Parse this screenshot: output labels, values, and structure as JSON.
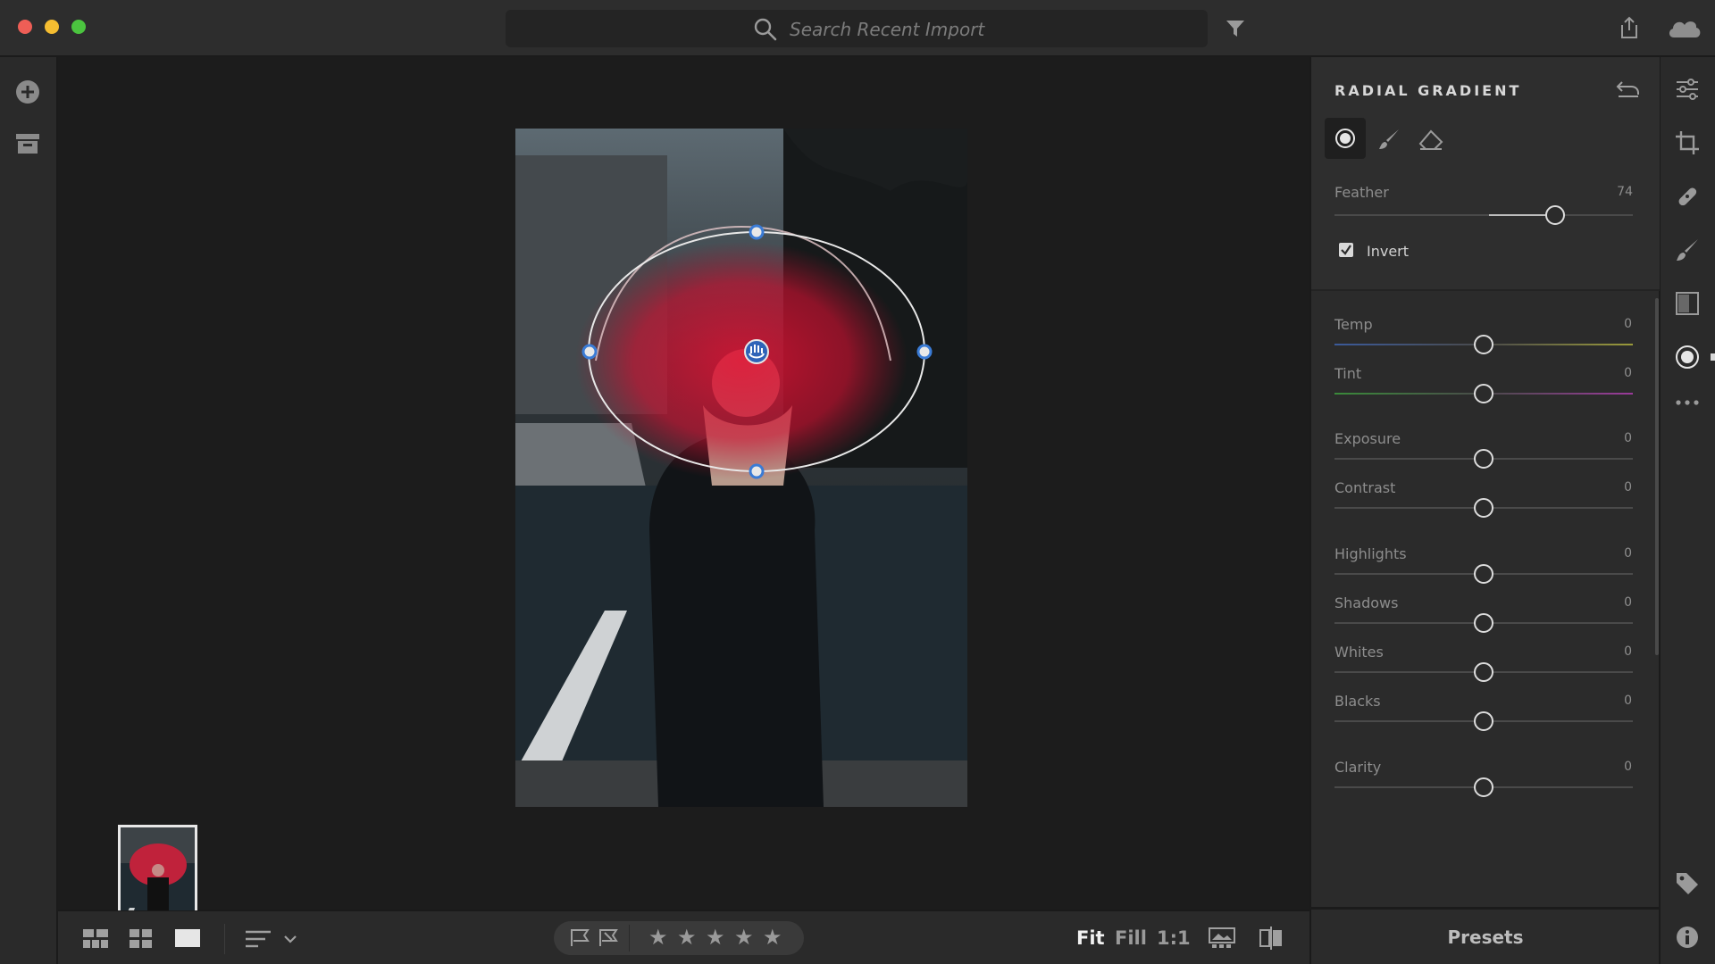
{
  "window": {
    "traffic_colors": [
      "#ee5e56",
      "#f5bd31",
      "#4bc43f"
    ]
  },
  "search": {
    "placeholder": "Search Recent Import",
    "icon": "search-icon"
  },
  "titlebar_icons": [
    "filter-icon",
    "share-icon",
    "cloud-icon"
  ],
  "left_rail": {
    "icons": [
      "add-photos-icon",
      "library-icon"
    ]
  },
  "panel": {
    "title": "RADIAL GRADIENT",
    "reset_icon": "reset-icon",
    "mask_tools": [
      "new-radial-icon",
      "brush-icon",
      "eraser-icon"
    ],
    "feather": {
      "label": "Feather",
      "value": "74",
      "fraction": 0.74
    },
    "invert": {
      "label": "Invert",
      "checked": true
    },
    "sliders": [
      {
        "key": "temp",
        "label": "Temp",
        "value": "0",
        "fraction": 0.5
      },
      {
        "key": "tint",
        "label": "Tint",
        "value": "0",
        "fraction": 0.5
      },
      {
        "key": "exposure",
        "label": "Exposure",
        "value": "0",
        "fraction": 0.5
      },
      {
        "key": "contrast",
        "label": "Contrast",
        "value": "0",
        "fraction": 0.5
      },
      {
        "key": "highlights",
        "label": "Highlights",
        "value": "0",
        "fraction": 0.5
      },
      {
        "key": "shadows",
        "label": "Shadows",
        "value": "0",
        "fraction": 0.5
      },
      {
        "key": "whites",
        "label": "Whites",
        "value": "0",
        "fraction": 0.5
      },
      {
        "key": "blacks",
        "label": "Blacks",
        "value": "0",
        "fraction": 0.5
      },
      {
        "key": "clarity",
        "label": "Clarity",
        "value": "0",
        "fraction": 0.5
      }
    ]
  },
  "presets": {
    "label": "Presets"
  },
  "bottom_bar": {
    "view_icons": [
      "square-grid-icon",
      "grid-icon",
      "detail-view-icon",
      "sort-icon"
    ],
    "flag_icons": [
      "flag-pick-icon",
      "flag-reject-icon"
    ],
    "stars": 5,
    "view_fit": "Fit",
    "view_fill": "Fill",
    "view_1to1": "1:1",
    "extra_icons": [
      "compare-icon",
      "before-after-icon"
    ]
  },
  "right_rail": {
    "icons": [
      "edit-sliders-icon",
      "crop-icon",
      "healing-icon",
      "brush-tool-icon",
      "linear-gradient-icon",
      "radial-gradient-icon",
      "more-icon",
      "keywords-icon",
      "info-icon"
    ],
    "active": "radial-gradient-icon"
  },
  "colors": {
    "mask_overlay": "#d0102c",
    "accent_knob": "#3a7bd5"
  }
}
